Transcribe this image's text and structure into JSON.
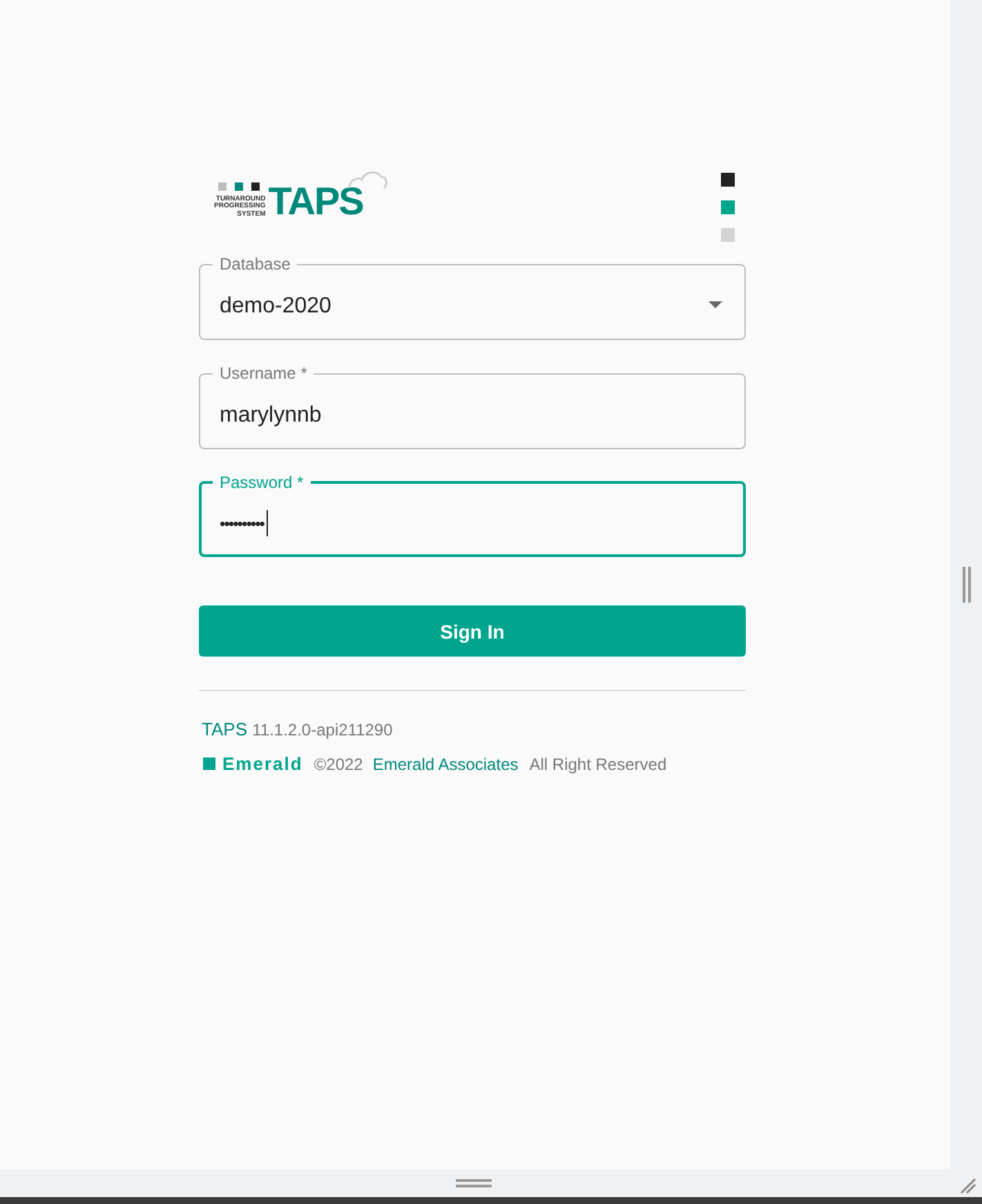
{
  "logo": {
    "tagline": [
      "TURNAROUND",
      "PROGRESSING",
      "SYSTEM"
    ],
    "name": "TAPS"
  },
  "fields": [
    {
      "kind": "select",
      "label": "Database",
      "value": "demo-2020",
      "focused": false
    },
    {
      "kind": "text",
      "label": "Username *",
      "value": "marylynnb",
      "focused": false
    },
    {
      "kind": "password",
      "label": "Password *",
      "value": "••••••••••",
      "focused": true
    }
  ],
  "sign_in_button": "Sign In",
  "version": {
    "product": "TAPS",
    "number": "11.1.2.0-api211290"
  },
  "footer": {
    "brand": "Emerald",
    "copyright": "©2022",
    "company": "Emerald Associates",
    "rights": "All Right Reserved"
  }
}
